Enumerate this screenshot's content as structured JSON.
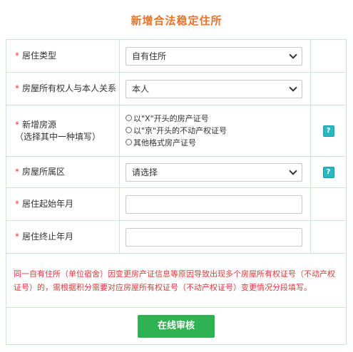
{
  "title": "新增合法稳定住所",
  "required_mark": "*",
  "fields": {
    "residence_type": {
      "label": "居住类型",
      "value": "自有住所"
    },
    "owner_relation": {
      "label": "房屋所有权人与本人关系",
      "value": "本人"
    },
    "house_source": {
      "label_line1": "新增房源",
      "label_line2": "（选择其中一种填写）",
      "options": [
        "以\"X\"开头的房产证号",
        "以\"京\"开头的不动产权证号",
        "其他格式房产证号"
      ],
      "help": "?"
    },
    "district": {
      "label": "房屋所属区",
      "value": "请选择",
      "help": "?"
    },
    "start_date": {
      "label": "居住起始年月",
      "value": ""
    },
    "end_date": {
      "label": "居住终止年月",
      "value": ""
    }
  },
  "notice": "同一自有住所（单位宿舍）因变更房产证信息等原因导致出现多个房屋所有权证号（不动产权证号）的，需根据积分需要对应房屋所有权证号（不动产权证号）变更情况分段填写。",
  "submit_label": "在线审核",
  "colors": {
    "title": "#e8742c",
    "required": "#e23b3b",
    "border": "#c9ead0",
    "button": "#2fb352",
    "help": "#27b8c2"
  }
}
